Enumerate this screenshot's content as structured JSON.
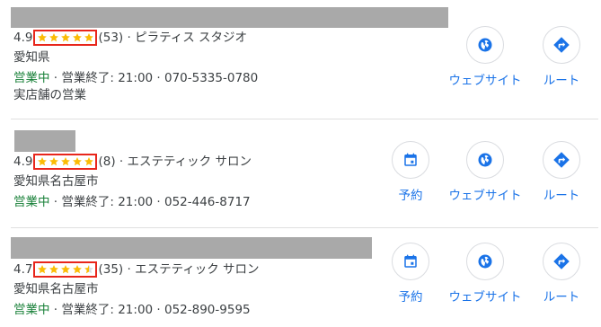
{
  "listings": [
    {
      "rating": "4.9",
      "stars": 4.9,
      "reviews": "(53)",
      "category_sep": " · ",
      "category": "ピラティス スタジオ",
      "address": "愛知県",
      "status": "営業中",
      "hours": " · 営業終了: 21:00 · 070-5335-0780",
      "note": "実店舗の営業",
      "actions": {
        "website": "ウェブサイト",
        "route": "ルート"
      }
    },
    {
      "rating": "4.9",
      "stars": 4.9,
      "reviews": "(8)",
      "category_sep": " · ",
      "category": "エステティック サロン",
      "address": "愛知県名古屋市",
      "status": "営業中",
      "hours": " · 営業終了: 21:00 · 052-446-8717",
      "actions": {
        "reserve": "予約",
        "website": "ウェブサイト",
        "route": "ルート"
      }
    },
    {
      "rating": "4.7",
      "stars": 4.7,
      "reviews": "(35)",
      "category_sep": " · ",
      "category": "エステティック サロン",
      "address": "愛知県名古屋市",
      "status": "営業中",
      "hours": " · 営業終了: 21:00 · 052-890-9595",
      "actions": {
        "reserve": "予約",
        "website": "ウェブサイト",
        "route": "ルート"
      }
    }
  ],
  "colors": {
    "accent": "#1a73e8",
    "open": "#188038",
    "star": "#fbbc04",
    "highlight": "#e8261b"
  },
  "icons": {
    "reserve": "calendar-icon",
    "website": "globe-icon",
    "route": "directions-icon"
  }
}
